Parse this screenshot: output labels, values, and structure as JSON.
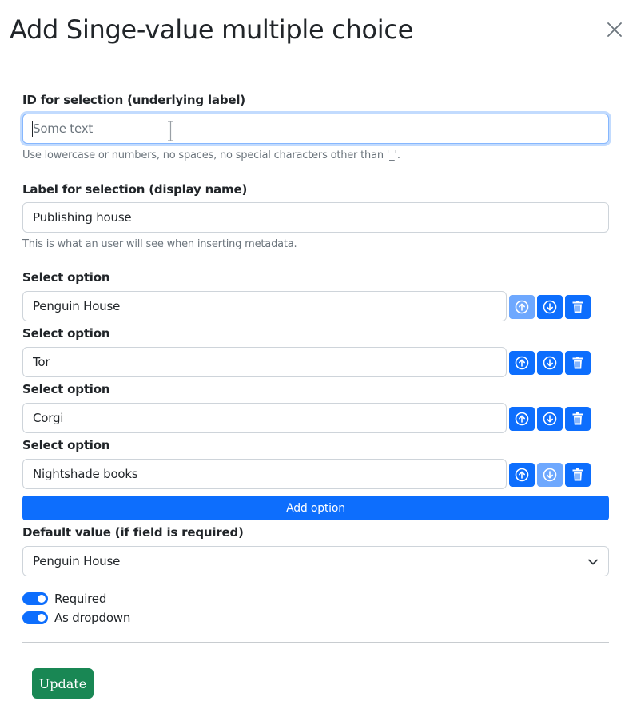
{
  "modal": {
    "title": "Add Singe-value multiple choice",
    "close_icon": "close-icon"
  },
  "id_field": {
    "label": "ID for selection (underlying label)",
    "value": "",
    "placeholder": "Some text",
    "help": "Use lowercase or numbers, no spaces, no special characters other than '_'."
  },
  "label_field": {
    "label": "Label for selection (display name)",
    "value": "Publishing house",
    "help": "This is what an user will see when inserting metadata."
  },
  "options": [
    {
      "label": "Select option",
      "value": "Penguin House",
      "up_disabled": true,
      "down_disabled": false
    },
    {
      "label": "Select option",
      "value": "Tor",
      "up_disabled": false,
      "down_disabled": false
    },
    {
      "label": "Select option",
      "value": "Corgi",
      "up_disabled": false,
      "down_disabled": false
    },
    {
      "label": "Select option",
      "value": "Nightshade books",
      "up_disabled": false,
      "down_disabled": true
    }
  ],
  "option_icons": {
    "up": "arrow-up-circle-icon",
    "down": "arrow-down-circle-icon",
    "delete": "trash-icon"
  },
  "add_option_label": "Add option",
  "default_value": {
    "label": "Default value (if field is required)",
    "selected": "Penguin House"
  },
  "toggles": {
    "required": {
      "label": "Required",
      "checked": true
    },
    "dropdown": {
      "label": "As dropdown",
      "checked": true
    }
  },
  "update_label": "Update",
  "colors": {
    "primary": "#0d6efd",
    "primary_disabled": "#6ea8fe",
    "success": "#198754",
    "focus_ring": "#86b7fe"
  }
}
